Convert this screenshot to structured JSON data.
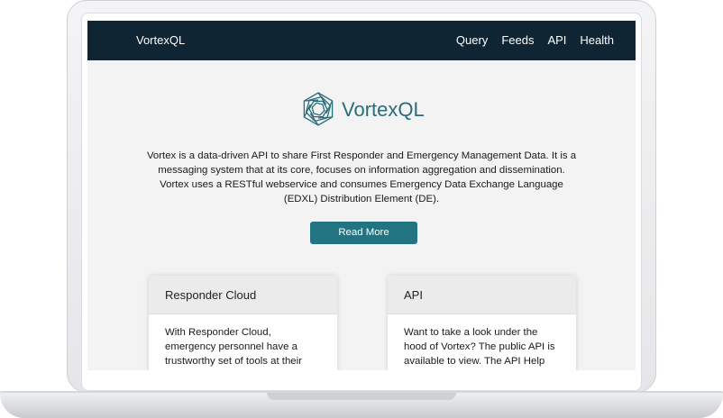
{
  "navbar": {
    "brand": "VortexQL",
    "links": [
      "Query",
      "Feeds",
      "API",
      "Health"
    ]
  },
  "hero": {
    "logo_text": "VortexQL",
    "description": "Vortex is a data-driven API to share First Responder and Emergency Management Data. It is a messaging system that at its core, focuses on information aggregation and dissemination. Vortex uses a RESTful webservice and consumes Emergency Data Exchange Language (EDXL) Distribution Element (DE).",
    "button_label": "Read More"
  },
  "cards": [
    {
      "title": "Responder Cloud",
      "body": "With Responder Cloud, emergency personnel have a trustworthy set of tools at their figure tips to optimize"
    },
    {
      "title": "API",
      "body": "Want to take a look under the hood of Vortex? The public API is available to view. The API Help page is"
    }
  ],
  "colors": {
    "navbar": "#0f2533",
    "accent": "#237482",
    "logo": "#2a6d7a"
  }
}
